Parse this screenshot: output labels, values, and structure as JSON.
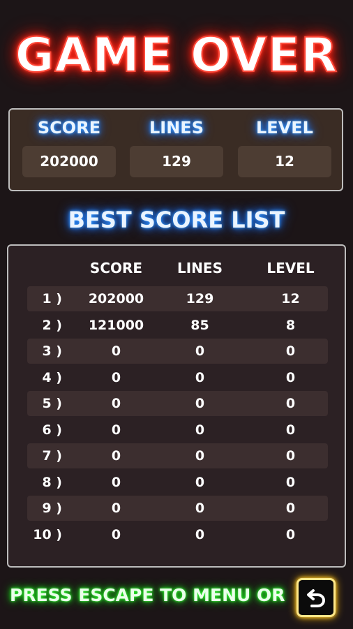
{
  "title": "GAME OVER",
  "summary": {
    "score_label": "SCORE",
    "lines_label": "LINES",
    "level_label": "LEVEL",
    "score": "202000",
    "lines": "129",
    "level": "12"
  },
  "best_list": {
    "title": "BEST SCORE LIST",
    "headers": {
      "score": "SCORE",
      "lines": "LINES",
      "level": "LEVEL"
    },
    "rows": [
      {
        "rank": "1 )",
        "score": "202000",
        "lines": "129",
        "level": "12"
      },
      {
        "rank": "2 )",
        "score": "121000",
        "lines": "85",
        "level": "8"
      },
      {
        "rank": "3 )",
        "score": "0",
        "lines": "0",
        "level": "0"
      },
      {
        "rank": "4 )",
        "score": "0",
        "lines": "0",
        "level": "0"
      },
      {
        "rank": "5 )",
        "score": "0",
        "lines": "0",
        "level": "0"
      },
      {
        "rank": "6 )",
        "score": "0",
        "lines": "0",
        "level": "0"
      },
      {
        "rank": "7 )",
        "score": "0",
        "lines": "0",
        "level": "0"
      },
      {
        "rank": "8 )",
        "score": "0",
        "lines": "0",
        "level": "0"
      },
      {
        "rank": "9 )",
        "score": "0",
        "lines": "0",
        "level": "0"
      },
      {
        "rank": "10 )",
        "score": "0",
        "lines": "0",
        "level": "0"
      }
    ]
  },
  "footer": {
    "text": "PRESS ESCAPE TO MENU OR",
    "button_icon": "undo-arrow-icon"
  },
  "colors": {
    "title_glow": "#ff2a1a",
    "label_glow": "#1f7cff",
    "footer_glow": "#20e020",
    "button_border": "#ffe88a"
  }
}
